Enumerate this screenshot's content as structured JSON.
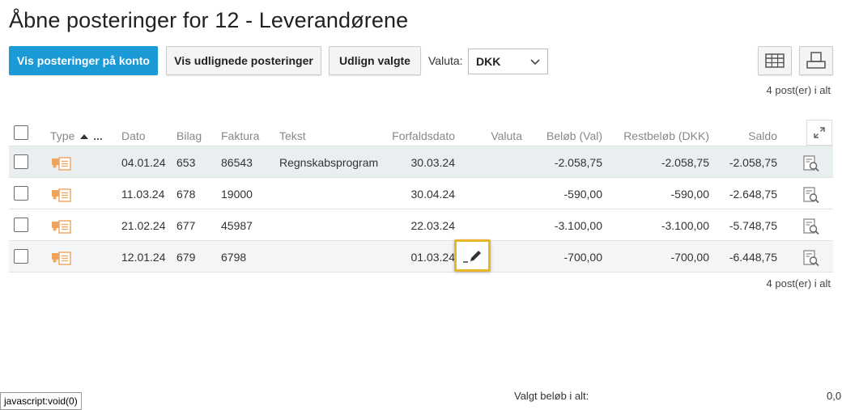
{
  "page": {
    "title": "Åbne posteringer for 12 - Leverandørene"
  },
  "toolbar": {
    "show_on_account": "Vis posteringer på konto",
    "show_settled": "Vis udlignede posteringer",
    "settle_selected": "Udlign valgte",
    "currency_label": "Valuta:",
    "currency_value": "DKK"
  },
  "count_top": "4 post(er) i alt",
  "count_bottom": "4 post(er) i alt",
  "table": {
    "headers": {
      "type": "Type",
      "type_suffix": "...",
      "date": "Dato",
      "voucher": "Bilag",
      "invoice": "Faktura",
      "text": "Tekst",
      "due_date": "Forfaldsdato",
      "currency": "Valuta",
      "amount": "Beløb (Val)",
      "rest": "Restbeløb (DKK)",
      "balance": "Saldo"
    },
    "rows": [
      {
        "date": "04.01.24",
        "voucher": "653",
        "invoice": "86543",
        "text": "Regnskabsprogram",
        "due": "30.03.24",
        "currency": "",
        "amount": "-2.058,75",
        "rest": "-2.058,75",
        "balance": "-2.058,75"
      },
      {
        "date": "11.03.24",
        "voucher": "678",
        "invoice": "19000",
        "text": "",
        "due": "30.04.24",
        "currency": "",
        "amount": "-590,00",
        "rest": "-590,00",
        "balance": "-2.648,75"
      },
      {
        "date": "21.02.24",
        "voucher": "677",
        "invoice": "45987",
        "text": "",
        "due": "22.03.24",
        "currency": "",
        "amount": "-3.100,00",
        "rest": "-3.100,00",
        "balance": "-5.748,75"
      },
      {
        "date": "12.01.24",
        "voucher": "679",
        "invoice": "6798",
        "text": "",
        "due": "01.03.24",
        "currency": "",
        "amount": "-700,00",
        "rest": "-700,00",
        "balance": "-6.448,75"
      }
    ]
  },
  "footer": {
    "label": "Valgt beløb i alt:",
    "value": "0,0"
  },
  "status_bar": "javascript:void(0)",
  "colors": {
    "primary": "#1a9ad6",
    "type_icon": "#f0a35c",
    "highlight": "#e9b52b"
  },
  "icons": [
    "chevron-down-icon",
    "table-columns-icon",
    "print-icon",
    "sort-asc-icon",
    "expand-icon",
    "supplier-invoice-icon",
    "view-document-icon",
    "pencil-icon"
  ]
}
